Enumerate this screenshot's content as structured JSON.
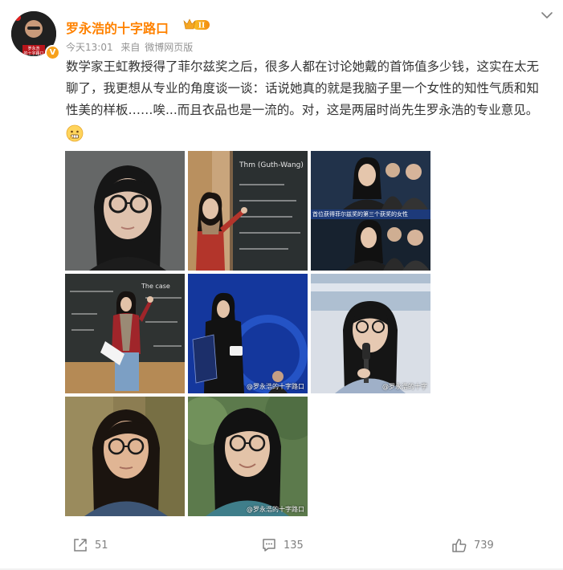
{
  "header": {
    "username": "罗永浩的十字路口",
    "vip_badge": "II",
    "time": "今天13:01",
    "source_prefix": "来自",
    "source": "微博网页版",
    "avatar_caption_line1": "罗永浩",
    "avatar_caption_line2": "的十字路口"
  },
  "post": {
    "text": "数学家王虹教授得了菲尔兹奖之后，很多人都在讨论她戴的首饰值多少钱，这实在太无聊了，我更想从专业的角度谈一谈：话说她真的就是我脑子里一个女性的知性气质和知性美的样板……唉...而且衣品也是一流的。对，这是两届时尚先生罗永浩的专业意见。",
    "emoji": "grimace-emoji"
  },
  "photos": [
    {
      "name": "photo-1-portrait-closeup",
      "watermark": ""
    },
    {
      "name": "photo-2-chalkboard-pointing",
      "watermark": "",
      "board_text": "Thm (Guth-Wang)"
    },
    {
      "name": "photo-3-tv-screencap",
      "watermark": "",
      "banner": "首位获得菲尔兹奖的第三个获奖的女性"
    },
    {
      "name": "photo-4-lecture-chalkboard",
      "watermark": "",
      "board_text": "The case"
    },
    {
      "name": "photo-5-award-stage",
      "watermark": "@罗永浩的十字路口"
    },
    {
      "name": "photo-6-microphone",
      "watermark": "@罗永浩的十字"
    },
    {
      "name": "photo-7-outdoor-portrait",
      "watermark": ""
    },
    {
      "name": "photo-8-headshot-smile",
      "watermark": "@罗永浩的十字路口"
    }
  ],
  "actions": {
    "share_count": "51",
    "comment_count": "135",
    "like_count": "739"
  },
  "colors": {
    "username": "#ff8200",
    "meta": "#939393",
    "text": "#333333",
    "action": "#808080"
  },
  "icons": [
    "verified-badge-icon",
    "vip-crown-icon",
    "chevron-down-icon",
    "share-icon",
    "comment-icon",
    "like-icon"
  ]
}
